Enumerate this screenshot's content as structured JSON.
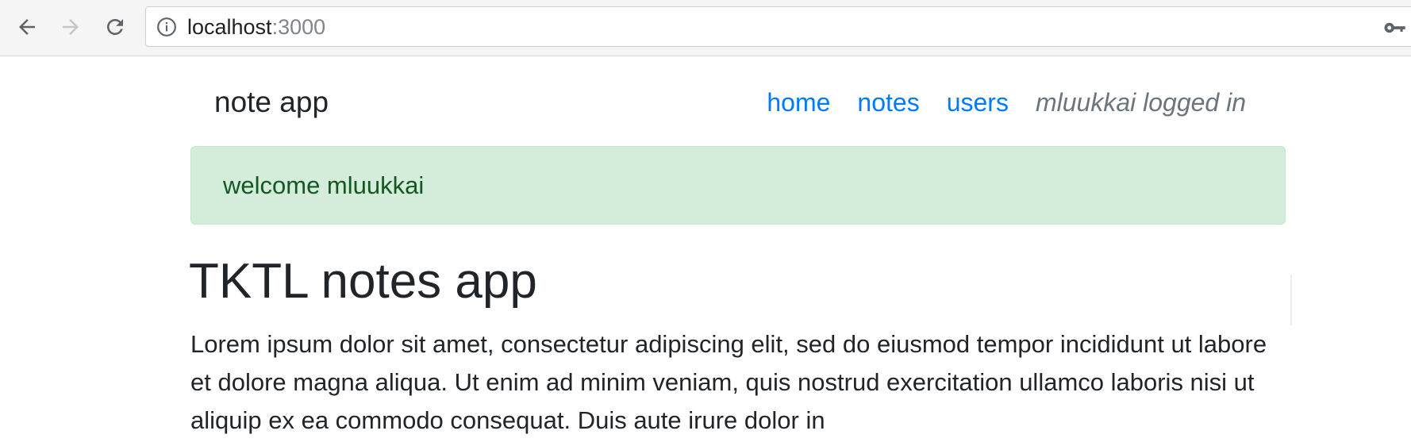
{
  "browser": {
    "back_icon": "arrow-left-icon",
    "forward_icon": "arrow-right-icon",
    "reload_icon": "reload-icon",
    "info_icon": "info-icon",
    "key_icon": "key-icon",
    "url_host": "localhost",
    "url_port": ":3000"
  },
  "navbar": {
    "brand": "note app",
    "links": [
      {
        "label": "home"
      },
      {
        "label": "notes"
      },
      {
        "label": "users"
      }
    ],
    "logged_in_text": "mluukkai logged in"
  },
  "alert": {
    "message": "welcome mluukkai"
  },
  "main": {
    "title": "TKTL notes app",
    "body": "Lorem ipsum dolor sit amet, consectetur adipiscing elit, sed do eiusmod tempor incididunt ut labore et dolore magna aliqua. Ut enim ad minim veniam, quis nostrud exercitation ullamco laboris nisi ut aliquip ex ea commodo consequat. Duis aute irure dolor in"
  },
  "colors": {
    "link": "#007bff",
    "alert_bg": "#d4edda",
    "alert_text": "#155724",
    "muted": "#6c757d"
  }
}
